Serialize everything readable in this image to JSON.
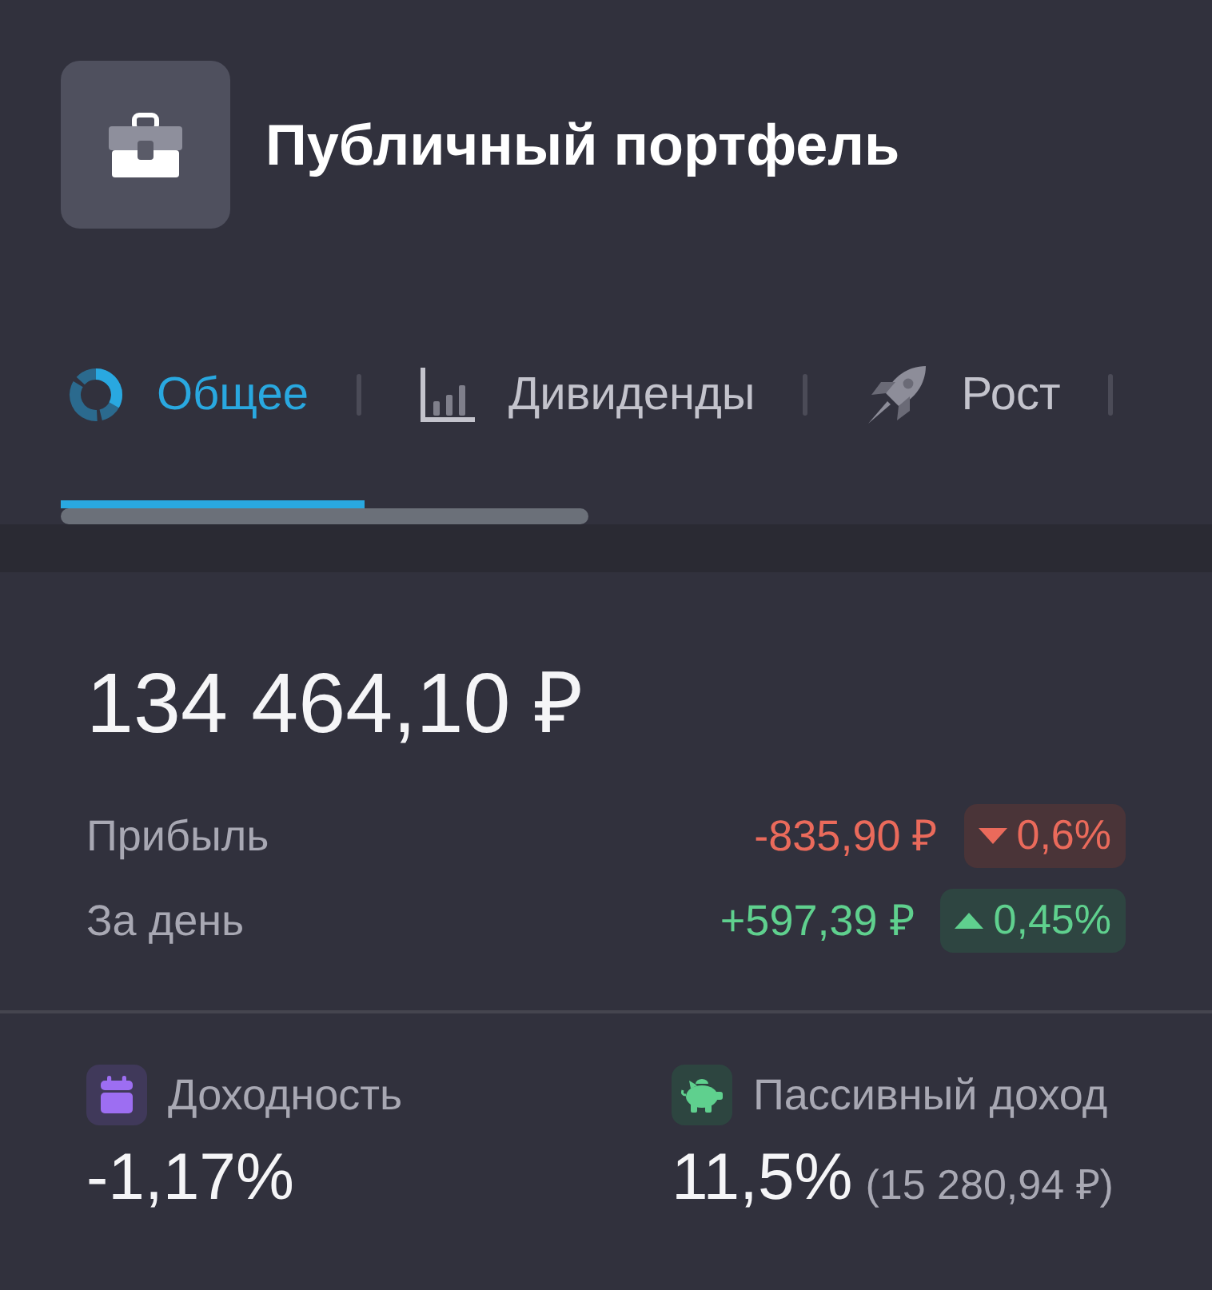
{
  "header": {
    "title": "Публичный портфель"
  },
  "tabs": [
    {
      "label": "Общее",
      "selected": true
    },
    {
      "label": "Дивиденды",
      "selected": false
    },
    {
      "label": "Рост",
      "selected": false
    }
  ],
  "summary": {
    "total": "134 464,10 ₽",
    "rows": [
      {
        "label": "Прибыль",
        "amount": "-835,90 ₽",
        "change": "0,6%",
        "gain": false
      },
      {
        "label": "За день",
        "amount": "+597,39 ₽",
        "change": "0,45%",
        "gain": true
      }
    ]
  },
  "metrics": [
    {
      "label": "Доходность",
      "value": "-1,17%"
    },
    {
      "label": "Пассивный доход",
      "value": "11,5%",
      "note": "(15 280,94 ₽)"
    }
  ]
}
